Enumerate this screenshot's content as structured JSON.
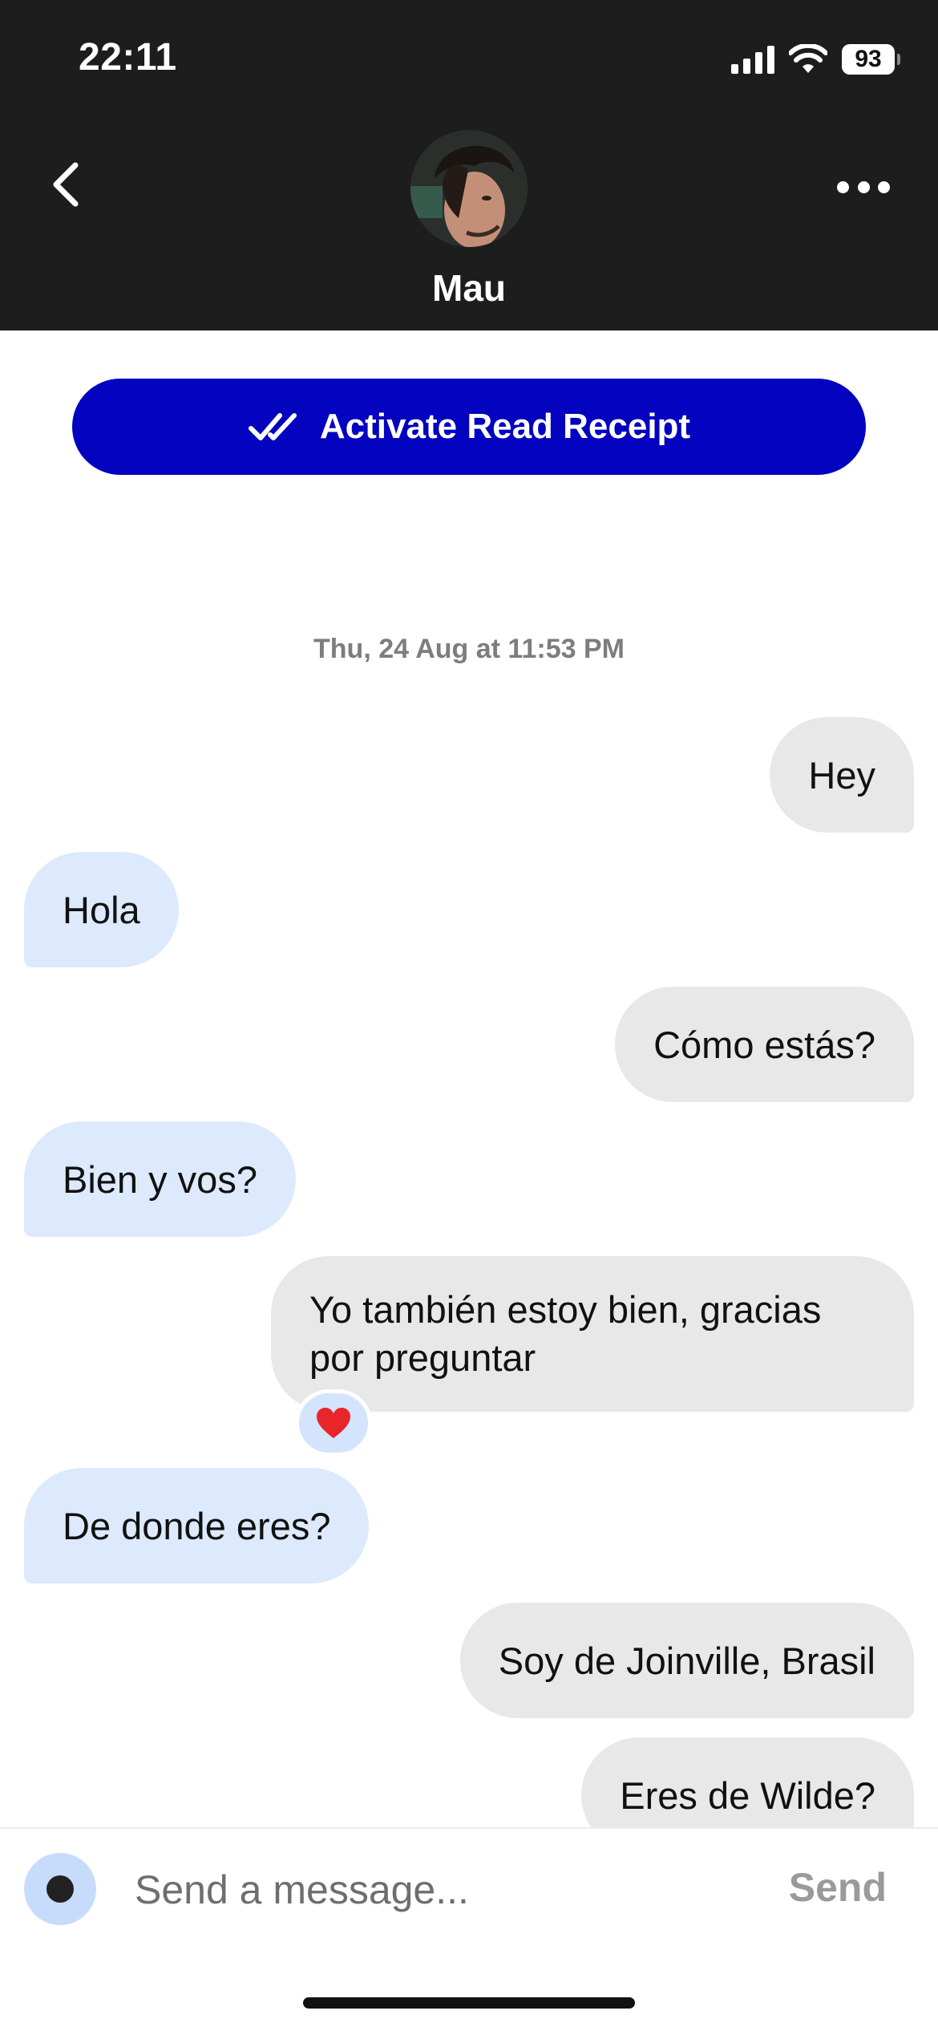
{
  "status_bar": {
    "time": "22:11",
    "battery": "93",
    "icons": [
      "signal-icon",
      "wifi-icon",
      "battery-icon"
    ]
  },
  "header": {
    "back_icon": "chevron-left-icon",
    "contact_name": "Mau",
    "more_icon": "more-horizontal-icon"
  },
  "read_receipt_button": {
    "label": "Activate Read Receipt",
    "icon": "double-check-icon",
    "color": "#0303c0"
  },
  "conversation": {
    "date": "Thu, 24 Aug at 11:53 PM",
    "messages": [
      {
        "direction": "out",
        "text": "Hey"
      },
      {
        "direction": "in",
        "text": "Hola"
      },
      {
        "direction": "out",
        "text": "Cómo estás?"
      },
      {
        "direction": "in",
        "text": "Bien y vos?"
      },
      {
        "direction": "out",
        "text": "Yo también estoy bien, gracias por preguntar",
        "reaction": "heart-icon"
      },
      {
        "direction": "in",
        "text": "De donde eres?"
      },
      {
        "direction": "out",
        "text": "Soy de Joinville, Brasil"
      },
      {
        "direction": "out",
        "text": "Eres de Wilde?"
      }
    ]
  },
  "composer": {
    "placeholder": "Send a message...",
    "value": "",
    "send_label": "Send"
  },
  "colors": {
    "header_bg": "#1d1d1d",
    "outgoing_bubble": "#e8e8e8",
    "incoming_bubble": "#dde9fc",
    "reaction_heart": "#e8262a"
  }
}
